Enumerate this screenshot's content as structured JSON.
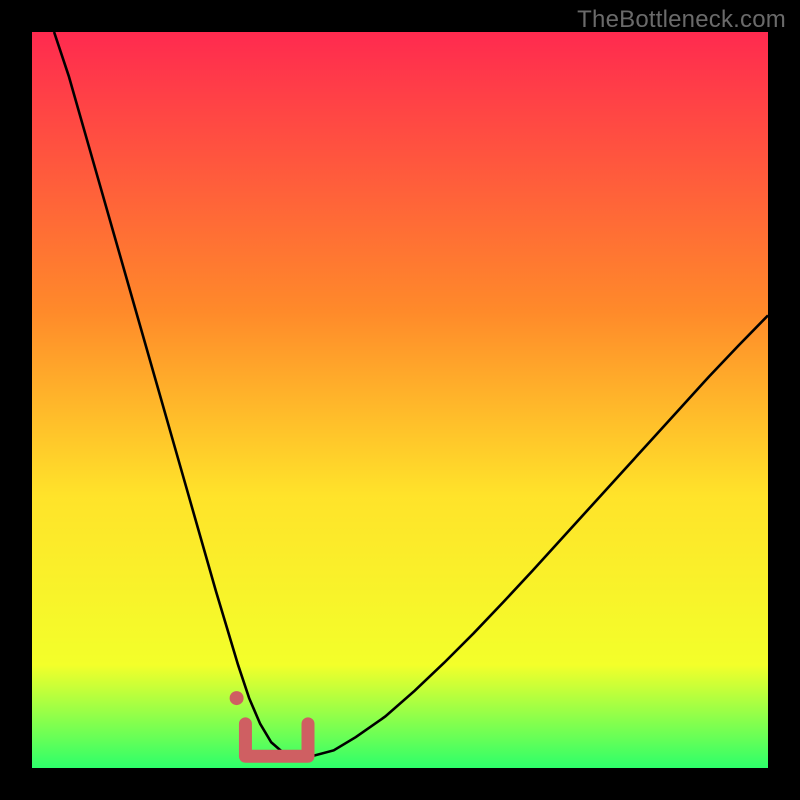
{
  "watermark": "TheBottleneck.com",
  "colors": {
    "frame": "#000000",
    "gradient_top": "#ff2a4f",
    "gradient_mid1": "#ff8a2a",
    "gradient_mid2": "#ffe32a",
    "gradient_mid3": "#f3ff2a",
    "gradient_bottom": "#2dff6a",
    "curve": "#000000",
    "marker": "#cf5f62"
  },
  "chart_data": {
    "type": "line",
    "title": "",
    "xlabel": "",
    "ylabel": "",
    "xlim": [
      0,
      100
    ],
    "ylim": [
      0,
      100
    ],
    "series": [
      {
        "name": "bottleneck-curve",
        "x": [
          3,
          5,
          7,
          9,
          11,
          13,
          15,
          17,
          19,
          21,
          23,
          25,
          26.5,
          28,
          29.5,
          31,
          32.5,
          34,
          36,
          38,
          41,
          44,
          48,
          52,
          56,
          60,
          64,
          68,
          72,
          76,
          80,
          84,
          88,
          92,
          96,
          100
        ],
        "y": [
          100,
          94,
          87,
          80,
          73,
          66,
          59,
          52,
          45,
          38,
          31,
          24,
          19,
          14,
          9.5,
          6,
          3.5,
          2.2,
          1.6,
          1.6,
          2.4,
          4.2,
          7.0,
          10.5,
          14.3,
          18.3,
          22.5,
          26.8,
          31.2,
          35.6,
          40.0,
          44.4,
          48.8,
          53.2,
          57.4,
          61.5
        ]
      }
    ],
    "markers": [
      {
        "type": "u-marker",
        "x_start": 29,
        "x_end": 37.5,
        "y_base": 1.6,
        "y_side": 6,
        "cap_y": 9.5,
        "cap_x": 27.8
      }
    ],
    "legend": [],
    "grid": false
  }
}
